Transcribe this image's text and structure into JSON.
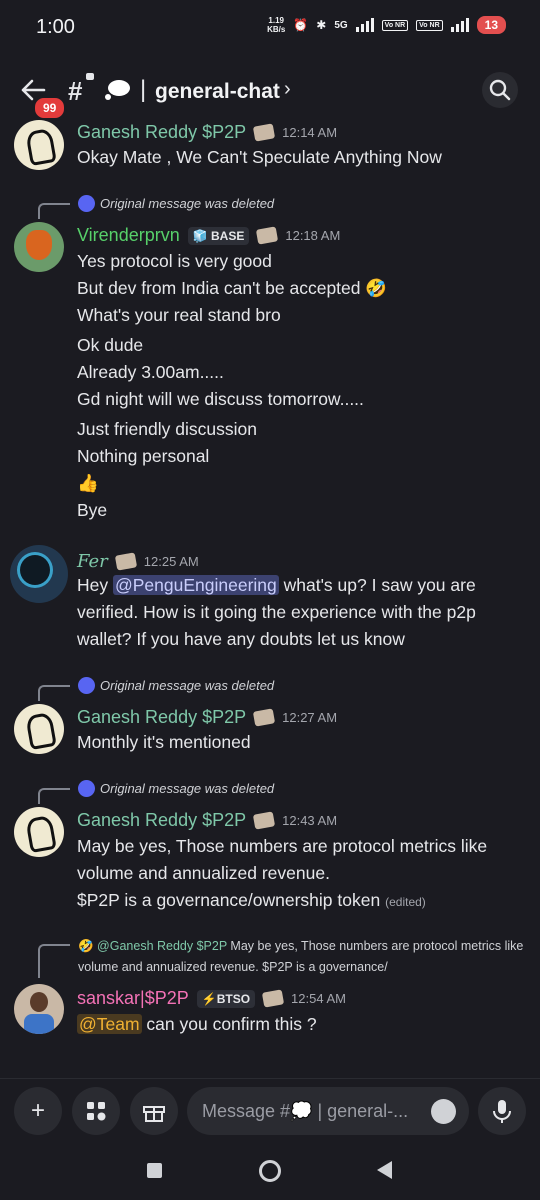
{
  "status_bar": {
    "time": "1:00",
    "speed": "1.19",
    "speed_unit": "KB/s",
    "net": "5G",
    "vo1": "Vo NR",
    "vo2": "Vo NR",
    "battery": "13"
  },
  "header": {
    "back_badge": "99",
    "hash": "#",
    "channel": "general-chat",
    "chevron": "›"
  },
  "messages": [
    {
      "author": "Ganesh Reddy $P2P",
      "author_color": "#7fc8a9",
      "time": "12:14 AM",
      "lines": [
        "Okay Mate , We Can't Speculate Anything Now"
      ]
    },
    {
      "reply": "Original message was deleted",
      "author": "Virenderprvn",
      "author_color": "#57d06a",
      "tag": "BASE",
      "time": "12:18 AM",
      "lines": [
        "Yes protocol is very good",
        "But dev from India can't be accepted 🤣",
        "What's your real stand bro",
        "Ok dude",
        "Already 3.00am.....",
        "Gd night will we discuss tomorrow.....",
        "Just friendly discussion",
        "Nothing personal",
        "👍",
        "Bye"
      ]
    },
    {
      "author": "Fer",
      "author_color": "#7fc8a9",
      "time": "12:25 AM",
      "line1_pre": "Hey ",
      "mention": "@PenguEngineering",
      "line1_post": " what's up? I saw you are",
      "lines": [
        "verified. How is it going the experience with the p2p",
        "wallet? If you have any doubts let us know"
      ]
    },
    {
      "reply": "Original message was deleted",
      "author": "Ganesh Reddy $P2P",
      "author_color": "#7fc8a9",
      "time": "12:27 AM",
      "lines": [
        "Monthly it's mentioned"
      ]
    },
    {
      "reply": "Original message was deleted",
      "author": "Ganesh Reddy $P2P",
      "author_color": "#7fc8a9",
      "time": "12:43 AM",
      "lines": [
        "May be yes, Those numbers are protocol metrics like",
        "volume and annualized revenue."
      ],
      "last_line": "$P2P is a governance/ownership token",
      "edited": "(edited)"
    },
    {
      "reply_author": "@Ganesh Reddy $P2P",
      "reply_text": " May be yes, Those numbers are protocol metrics like volume and annualized revenue. $P2P is a governance/",
      "author": "sanskar|$P2P",
      "author_color": "#f472b6",
      "tag": "BTSO",
      "time": "12:54 AM",
      "mention": "@Team",
      "line_post": " can you confirm this ?"
    }
  ],
  "composer": {
    "placeholder": "Message #💭 | general-..."
  },
  "icons": [
    "back-arrow-icon",
    "lock-icon",
    "thought-bubble-icon",
    "search-icon",
    "plus-icon",
    "apps-icon",
    "gift-icon",
    "emoji-icon",
    "microphone-icon",
    "discord-icon"
  ]
}
